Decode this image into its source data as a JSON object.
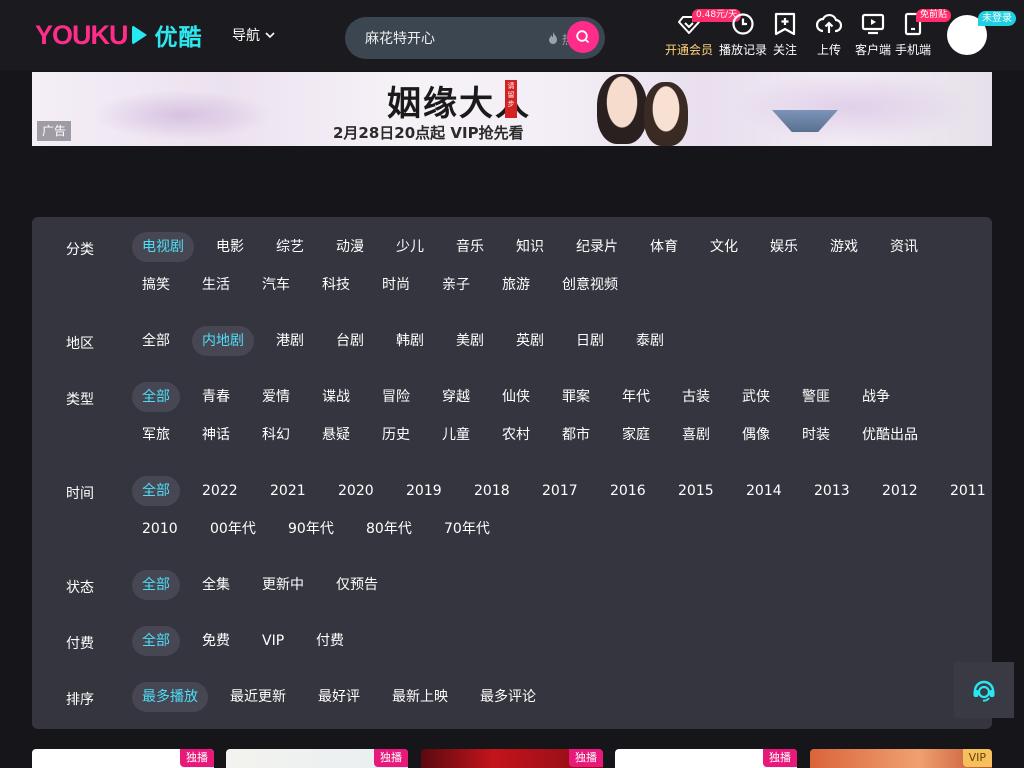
{
  "header": {
    "logo_en": "YOUKU",
    "logo_cn": "优酷",
    "nav_label": "导航",
    "search": {
      "value": "麻花特开心",
      "hot_text": "热搜"
    },
    "items": [
      {
        "key": "vip",
        "label": "开通会员",
        "icon": "diamond-icon",
        "tag": "0.48元/天"
      },
      {
        "key": "history",
        "label": "播放记录",
        "icon": "clock-icon"
      },
      {
        "key": "follow",
        "label": "关注",
        "icon": "bookmark-plus-icon"
      },
      {
        "key": "upload",
        "label": "上传",
        "icon": "cloud-upload-icon"
      },
      {
        "key": "client",
        "label": "客户端",
        "icon": "monitor-play-icon"
      },
      {
        "key": "mobile",
        "label": "手机端",
        "icon": "phone-icon",
        "tag": "免前贴"
      }
    ],
    "login_tag": "未登录"
  },
  "banner": {
    "ad_label": "广告",
    "title": "姻缘大人",
    "seal": "请留步",
    "subtitle": "2月28日20点起 VIP抢先看"
  },
  "filters": [
    {
      "label": "分类",
      "active": 0,
      "rows": [
        [
          "电视剧",
          "电影",
          "综艺",
          "动漫",
          "少儿",
          "音乐",
          "知识",
          "纪录片",
          "体育",
          "文化",
          "娱乐",
          "游戏",
          "资讯"
        ],
        [
          "搞笑",
          "生活",
          "汽车",
          "科技",
          "时尚",
          "亲子",
          "旅游",
          "创意视频"
        ]
      ]
    },
    {
      "label": "地区",
      "active": 1,
      "rows": [
        [
          "全部",
          "内地剧",
          "港剧",
          "台剧",
          "韩剧",
          "美剧",
          "英剧",
          "日剧",
          "泰剧"
        ]
      ]
    },
    {
      "label": "类型",
      "active": 0,
      "rows": [
        [
          "全部",
          "青春",
          "爱情",
          "谍战",
          "冒险",
          "穿越",
          "仙侠",
          "罪案",
          "年代",
          "古装",
          "武侠",
          "警匪",
          "战争"
        ],
        [
          "军旅",
          "神话",
          "科幻",
          "悬疑",
          "历史",
          "儿童",
          "农村",
          "都市",
          "家庭",
          "喜剧",
          "偶像",
          "时装",
          "优酷出品"
        ]
      ]
    },
    {
      "label": "时间",
      "active": 0,
      "rows": [
        [
          "全部",
          "2022",
          "2021",
          "2020",
          "2019",
          "2018",
          "2017",
          "2016",
          "2015",
          "2014",
          "2013",
          "2012",
          "2011"
        ],
        [
          "2010",
          "00年代",
          "90年代",
          "80年代",
          "70年代"
        ]
      ]
    },
    {
      "label": "状态",
      "active": 0,
      "rows": [
        [
          "全部",
          "全集",
          "更新中",
          "仅预告"
        ]
      ]
    },
    {
      "label": "付费",
      "active": 0,
      "rows": [
        [
          "全部",
          "免费",
          "VIP",
          "付费"
        ]
      ]
    },
    {
      "label": "排序",
      "active": 0,
      "rows": [
        [
          "最多播放",
          "最近更新",
          "最好评",
          "最新上映",
          "最多评论"
        ]
      ]
    }
  ],
  "cards": [
    {
      "badge": "独播",
      "badge_type": "exclusive"
    },
    {
      "badge": "独播",
      "badge_type": "exclusive"
    },
    {
      "badge": "独播",
      "badge_type": "exclusive"
    },
    {
      "badge": "独播",
      "badge_type": "exclusive"
    },
    {
      "badge": "VIP",
      "badge_type": "vip"
    }
  ],
  "colors": {
    "accent_pink": "#ff2d89",
    "accent_cyan": "#27e8f2",
    "active_text": "#4fdcf5",
    "panel_bg": "#35353f",
    "page_bg": "#16161a"
  }
}
